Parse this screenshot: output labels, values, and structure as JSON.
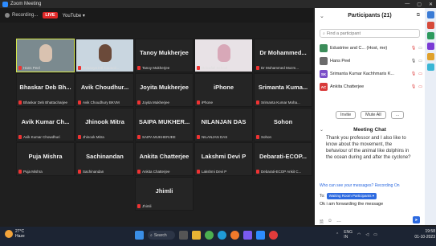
{
  "window": {
    "title": "Zoom Meeting",
    "controls": [
      "—",
      "▢",
      "✕"
    ]
  },
  "topbar": {
    "recording_label": "Recording...",
    "live_badge": "LIVE",
    "youtube_label": "YouTube ▾"
  },
  "grid": {
    "tiles": [
      {
        "name": "",
        "label": "Hans Peel"
      },
      {
        "name": "",
        "label": "EVaanya Intl Council..."
      },
      {
        "name": "Tanoy Mukherjee",
        "label": "Tanoy Mukherjee"
      },
      {
        "name": "",
        "label": "Dolcafall School"
      },
      {
        "name": "Dr Mohammed...",
        "label": "Dr Mohammed Mozm..."
      },
      {
        "name": "Bhaskar Deb Bh...",
        "label": "Bhaskar Deb Bhattacharjee"
      },
      {
        "name": "Avik Choudhur...",
        "label": "Avik Choudhury BKVM"
      },
      {
        "name": "Joyita Mukherjee",
        "label": "Joyita Mukherjee"
      },
      {
        "name": "iPhone",
        "label": "iPhone"
      },
      {
        "name": "Srimanta Kuma...",
        "label": "Srimanta Kumar Moha..."
      },
      {
        "name": "Avik Kumar Ch...",
        "label": "Avik Kumar Chowdhuri"
      },
      {
        "name": "Jhinook Mitra",
        "label": "Jhinook Mitra"
      },
      {
        "name": "SAIPA MUKHER...",
        "label": "SAIPA MUKHERJEE"
      },
      {
        "name": "NILANJAN DAS",
        "label": "NILANJAN DAS"
      },
      {
        "name": "Sohon",
        "label": "Sohon"
      },
      {
        "name": "Puja Mishra",
        "label": "Puja Mishra"
      },
      {
        "name": "Sachinandan",
        "label": "Sachinandan"
      },
      {
        "name": "Ankita Chatterjee",
        "label": "Ankita Chatterjee"
      },
      {
        "name": "Lakshmi Devi P",
        "label": "Lakshmi Devi P"
      },
      {
        "name": "Debarati-ECOP...",
        "label": "Debarati-ECOP Ankit C..."
      },
      {
        "name": "Jhimli",
        "label": "Jhimli"
      }
    ]
  },
  "participants": {
    "title": "Participants (21)",
    "search_placeholder": "Find a participant",
    "list": [
      {
        "initials": "",
        "name": "Edustrine and C... (Host, me)",
        "color": "#3c8d5a"
      },
      {
        "initials": "",
        "name": "Hans Peel",
        "color": "#6b6b6b"
      },
      {
        "initials": "SK",
        "name": "Srimanta Kumar Kachhmaris K...",
        "color": "#7b4fc9"
      },
      {
        "initials": "AC",
        "name": "Ankita Chatterjee",
        "color": "#d83a3a"
      }
    ],
    "invite_label": "Invite",
    "mute_all_label": "Mute All",
    "more_label": "..."
  },
  "chat": {
    "title": "Meeting Chat",
    "message": "Thank you professor and I also like to know about the movement, the behaviour of the animal like dolphins in the ocean during and after the cyclone?",
    "who_can_see": "Who can see your messages? Recording On",
    "to_label": "To:",
    "to_value": "Waiting Room Participants ▾",
    "draft": "Ok i am forwarding the message"
  },
  "taskbar": {
    "weather_temp": "27°C",
    "weather_desc": "Haze",
    "search_label": "Search",
    "lang": "ENG\nIN",
    "time": "19:58",
    "date": "01-10-2023"
  },
  "colors": {
    "accent": "#2d8cff",
    "active_speaker": "#d6e84a",
    "live": "#e02828"
  }
}
